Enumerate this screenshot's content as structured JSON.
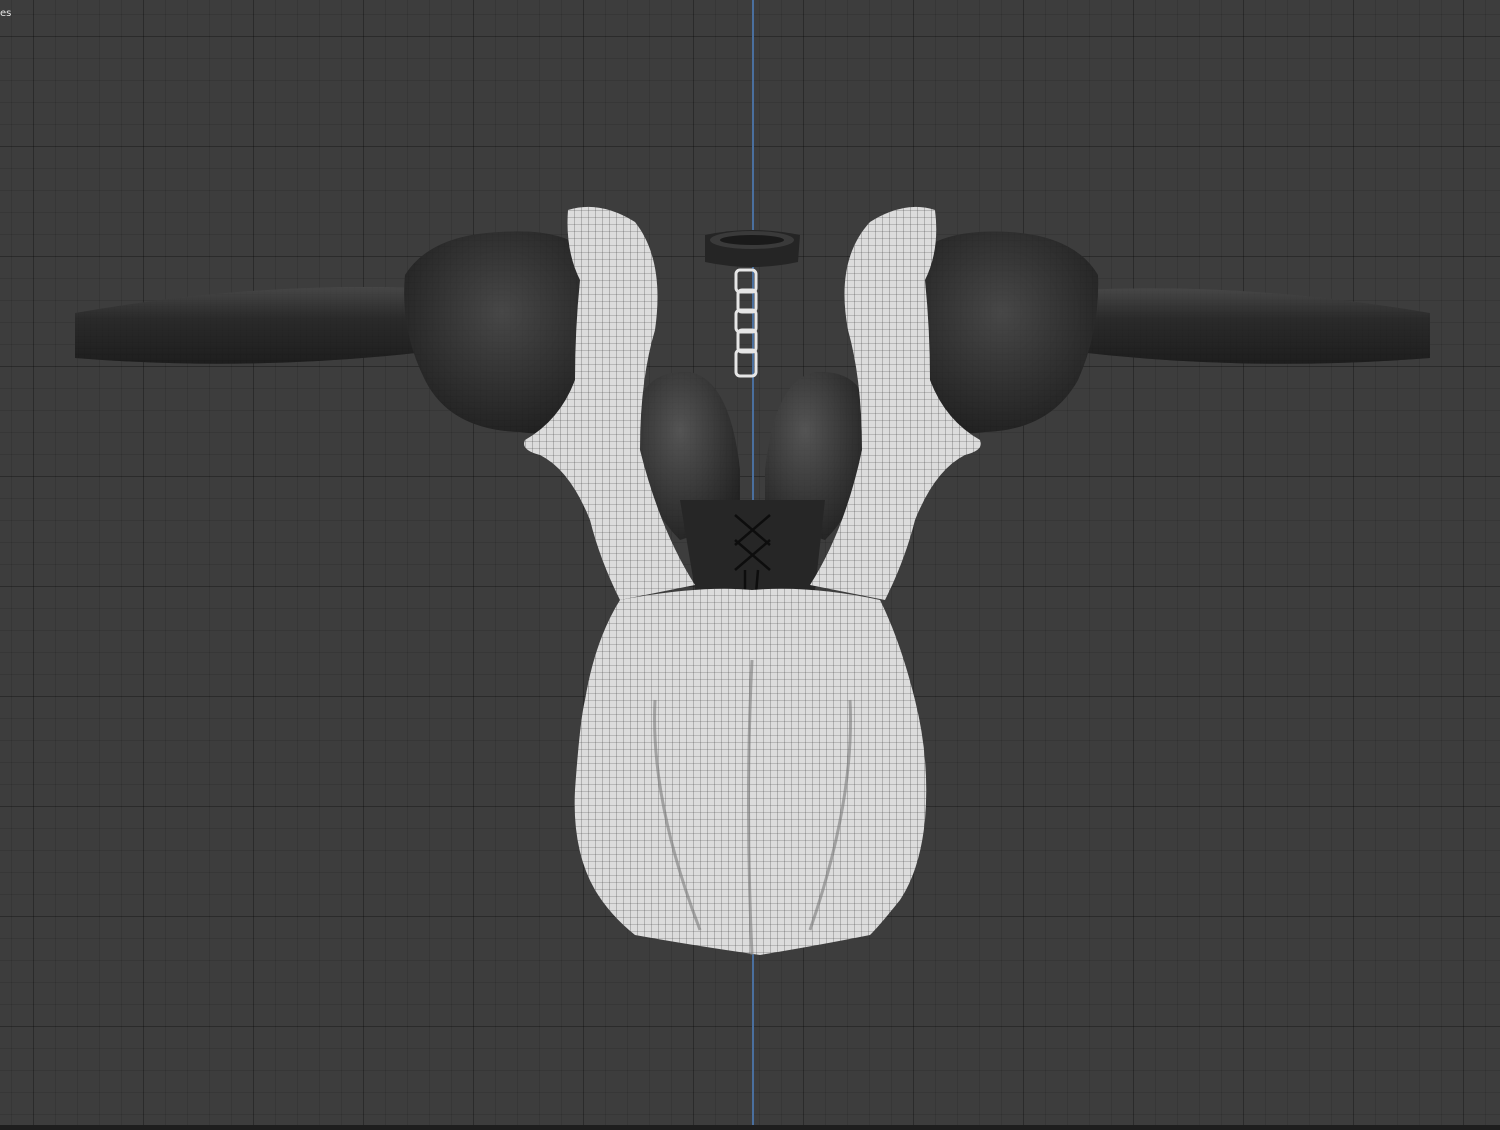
{
  "viewport": {
    "corner_label": "es"
  },
  "colors": {
    "background": "#3d3d3d",
    "axis": "#4a6f9e",
    "fabric_white": "#d6d6d6",
    "fabric_black": "#2a2a2a"
  }
}
